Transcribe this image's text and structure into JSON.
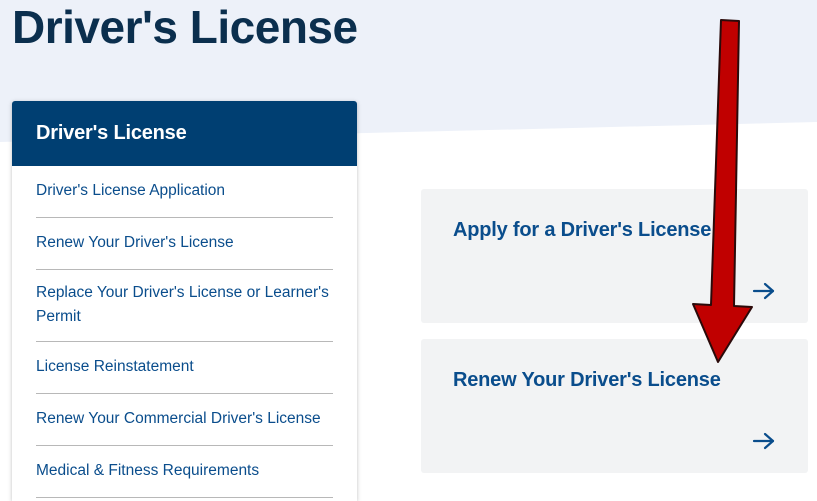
{
  "page": {
    "title": "Driver's License"
  },
  "sidebar": {
    "header": "Driver's License",
    "items": [
      {
        "label": "Driver's License Application"
      },
      {
        "label": "Renew Your Driver's License"
      },
      {
        "label": "Replace Your Driver's License or Learner's Permit"
      },
      {
        "label": "License Reinstatement"
      },
      {
        "label": "Renew Your Commercial Driver's License"
      },
      {
        "label": "Medical & Fitness Requirements"
      }
    ]
  },
  "cards": [
    {
      "title": "Apply for a Driver's License",
      "icon": "arrow-right-icon"
    },
    {
      "title": "Renew Your Driver's License",
      "icon": "arrow-right-icon"
    }
  ],
  "annotation": {
    "icon": "red-arrow-down-icon",
    "color": "#c00000"
  },
  "colors": {
    "brand": "#003f72",
    "link": "#0a4d8c",
    "hero_bg": "#edf1f9",
    "card_bg": "#f2f3f4"
  }
}
